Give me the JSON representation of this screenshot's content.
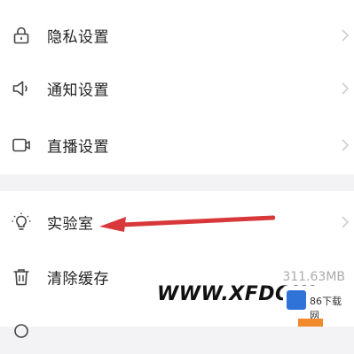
{
  "settings_group_1": {
    "items": [
      {
        "label": "隐私设置",
        "icon": "lock-icon"
      },
      {
        "label": "通知设置",
        "icon": "speaker-icon"
      },
      {
        "label": "直播设置",
        "icon": "video-camera-icon"
      }
    ]
  },
  "settings_group_2": {
    "items": [
      {
        "label": "实验室",
        "icon": "lightbulb-icon"
      },
      {
        "label": "清除缓存",
        "icon": "trash-icon",
        "value": "311.63MB"
      }
    ]
  },
  "watermark": {
    "text": "WWW.XFDOW",
    "logo_text": "86下载网"
  },
  "colors": {
    "annotation_arrow": "#d9383a",
    "watermark_badge": "#2f73d9"
  }
}
